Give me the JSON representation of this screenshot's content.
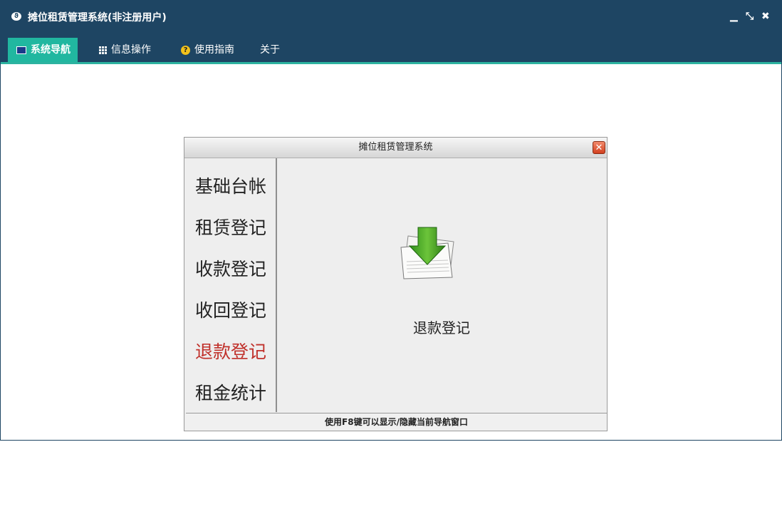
{
  "window": {
    "title": "摊位租赁管理系统(非注册用户)",
    "controls": {
      "minimize": "▁",
      "restore": "⤡",
      "close": "✖"
    }
  },
  "menu": [
    {
      "label": "系统导航",
      "icon": "monitor-icon",
      "active": true
    },
    {
      "label": "信息操作",
      "icon": "grid-icon",
      "active": false
    },
    {
      "label": "使用指南",
      "icon": "help-icon",
      "active": false
    },
    {
      "label": "关于",
      "icon": "",
      "active": false
    }
  ],
  "dialog": {
    "title": "摊位租赁管理系统",
    "close_glyph": "✕",
    "nav_items": [
      {
        "label": "基础台帐",
        "selected": false
      },
      {
        "label": "租赁登记",
        "selected": false
      },
      {
        "label": "收款登记",
        "selected": false
      },
      {
        "label": "收回登记",
        "selected": false
      },
      {
        "label": "退款登记",
        "selected": true
      },
      {
        "label": "租金统计",
        "selected": false
      }
    ],
    "content": {
      "icon": "download-arrow-icon",
      "label": "退款登记"
    },
    "status": "使用F8键可以显示/隐藏当前导航窗口"
  },
  "colors": {
    "titlebar": "#1e4563",
    "accent": "#21b7a0",
    "selected_nav": "#c0302a"
  }
}
